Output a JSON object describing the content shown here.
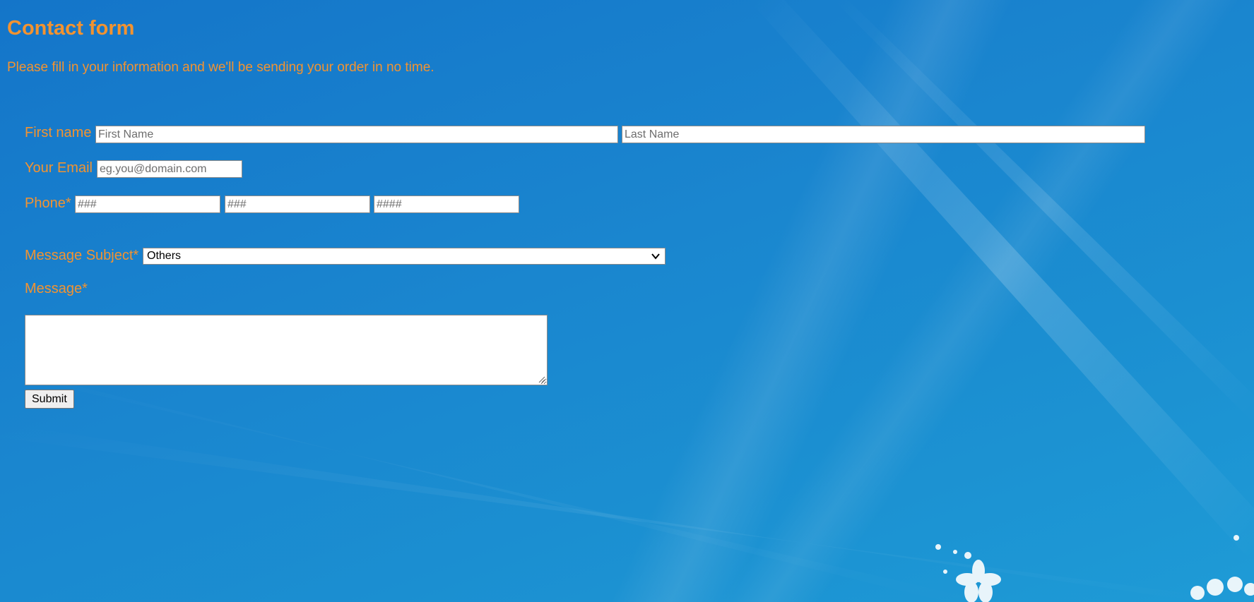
{
  "header": {
    "title": "Contact form",
    "subtitle": "Please fill in your information and we'll be sending your order in no time."
  },
  "form": {
    "first_name_label": "First name",
    "first_name_placeholder": "First Name",
    "last_name_placeholder": "Last Name",
    "email_label": "Your Email",
    "email_placeholder": "eg.you@domain.com",
    "phone_label": "Phone*",
    "phone_area_placeholder": "###",
    "phone_prefix_placeholder": "###",
    "phone_line_placeholder": "####",
    "subject_label": "Message Subject*",
    "subject_selected": "Others",
    "message_label": "Message*",
    "message_value": "",
    "submit_label": "Submit"
  },
  "colors": {
    "label": "#f39330",
    "background": "#1a86cf"
  }
}
